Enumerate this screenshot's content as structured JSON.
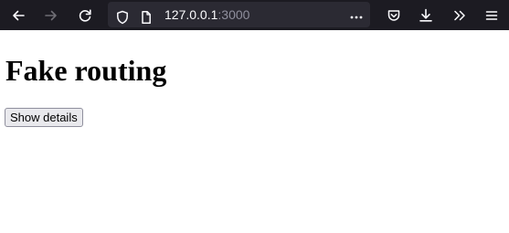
{
  "browser": {
    "url_host": "127.0.0.1",
    "url_port": ":3000",
    "icons": {
      "back": "back-arrow-icon",
      "forward": "forward-arrow-icon",
      "reload": "reload-icon",
      "tracking": "shield-icon",
      "page_info": "page-icon",
      "page_actions": "more-icon",
      "pocket": "pocket-icon",
      "downloads": "download-icon",
      "overflow": "overflow-chevrons-icon",
      "menu": "hamburger-menu-icon"
    },
    "colors": {
      "toolbar_bg": "#1c1b22",
      "urlbar_bg": "#2b2a33",
      "url_text": "#fbfbfe",
      "url_port": "#8f8f9d",
      "icon": "#fbfbfe",
      "icon_disabled": "#6f6e75"
    }
  },
  "page": {
    "heading": "Fake routing",
    "button_label": "Show details"
  }
}
